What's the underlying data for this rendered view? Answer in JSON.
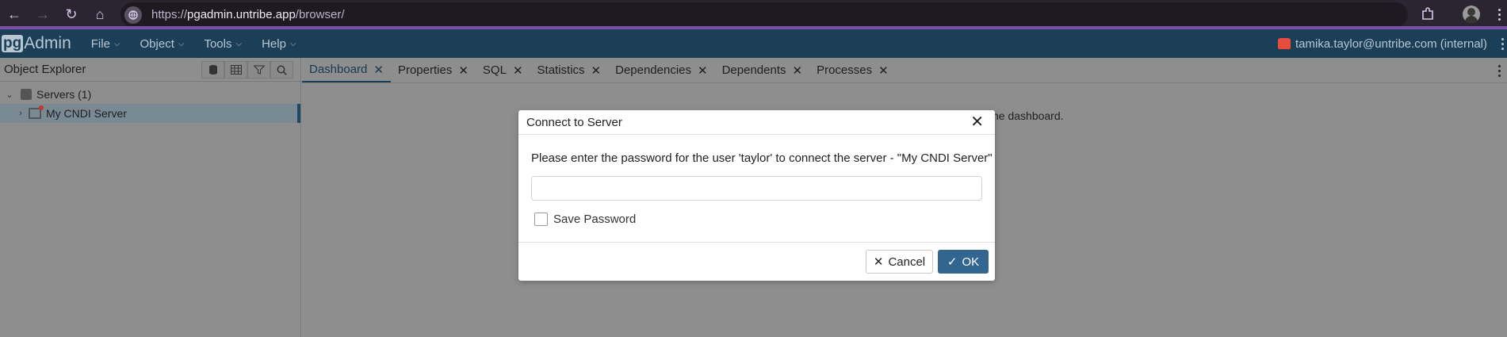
{
  "browser": {
    "url_prefix": "https://",
    "url_domain": "pgadmin.untribe.app",
    "url_path": "/browser/"
  },
  "app": {
    "logo_pg": "pg",
    "logo_text": "Admin",
    "menu": [
      "File",
      "Object",
      "Tools",
      "Help"
    ],
    "user": "tamika.taylor@untribe.com (internal)"
  },
  "explorer": {
    "title": "Object Explorer",
    "tree": [
      {
        "label": "Servers (1)",
        "expanded": true
      },
      {
        "label": "My CNDI Server",
        "expanded": false,
        "selected": true
      }
    ]
  },
  "tabs": [
    {
      "label": "Dashboard",
      "active": true
    },
    {
      "label": "Properties"
    },
    {
      "label": "SQL"
    },
    {
      "label": "Statistics"
    },
    {
      "label": "Dependencies"
    },
    {
      "label": "Dependents"
    },
    {
      "label": "Processes"
    }
  ],
  "background_message": "he dashboard.",
  "dialog": {
    "title": "Connect to Server",
    "message": "Please enter the password for the user 'taylor' to connect the server - \"My CNDI Server\"",
    "password_value": "",
    "save_password_label": "Save Password",
    "save_password_checked": false,
    "cancel_label": "Cancel",
    "ok_label": "OK"
  },
  "colors": {
    "header": "#1b3f57",
    "ok_button": "#326690",
    "browser_accent": "#7b4fa8"
  }
}
